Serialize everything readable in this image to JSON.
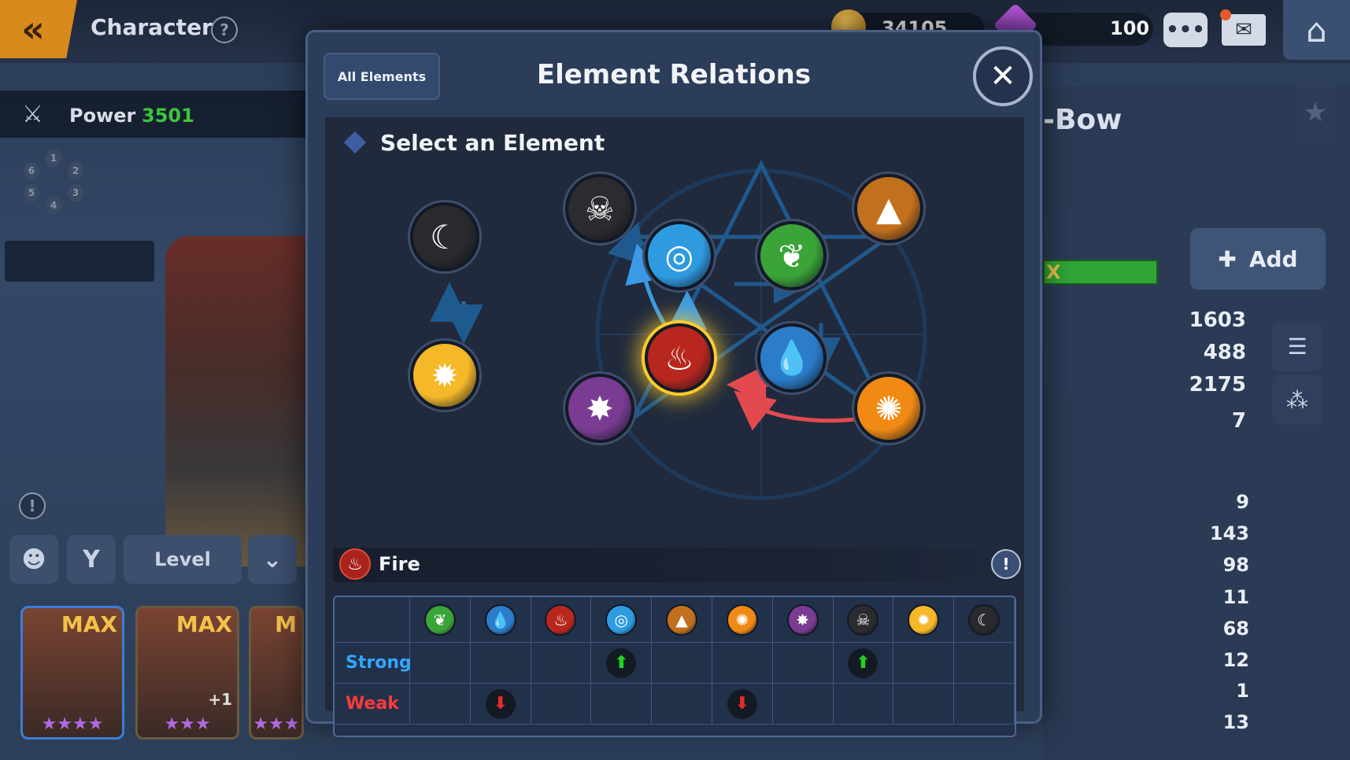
{
  "topbar": {
    "title": "Character",
    "help": "?",
    "coins": "34105",
    "gems": "100"
  },
  "left": {
    "power_label": "Power",
    "power_value": "3501",
    "slots": [
      "1",
      "2",
      "3",
      "4",
      "5",
      "6"
    ],
    "info": "!",
    "level_label": "Level"
  },
  "heroes": [
    {
      "badge": "MAX",
      "stars": "★★★★"
    },
    {
      "badge": "MAX",
      "stars": "★★★",
      "plus": "+1"
    },
    {
      "badge": "M",
      "stars": "★★★"
    }
  ],
  "right": {
    "item_title": "-Bow",
    "add_label": "Add",
    "xp_text": "X",
    "stats_top": [
      "1603",
      "488",
      "2175",
      "7"
    ],
    "stats_bottom": [
      "9",
      "143",
      "98",
      "11",
      "68",
      "12",
      "1",
      "13"
    ]
  },
  "modal": {
    "all_elements_label": "All Elements",
    "title": "Element Relations",
    "close": "✕",
    "select_label": "Select an Element",
    "selected_element": "Fire",
    "info": "!"
  },
  "elements": {
    "moon": {
      "glyph": "☾",
      "color": "#2a2a2e"
    },
    "sun": {
      "glyph": "✹",
      "color": "#f4b829"
    },
    "skull": {
      "glyph": "☠",
      "color": "#2c2c30"
    },
    "wind": {
      "glyph": "◎",
      "color": "#2e9be0"
    },
    "nature": {
      "glyph": "❦",
      "color": "#3aa438"
    },
    "earth": {
      "glyph": "▲",
      "color": "#c2701e"
    },
    "fire": {
      "glyph": "♨",
      "color": "#b8271e"
    },
    "water": {
      "glyph": "💧",
      "color": "#2b7cc9"
    },
    "star": {
      "glyph": "✸",
      "color": "#7a3c92"
    },
    "light": {
      "glyph": "✺",
      "color": "#f08a14"
    }
  },
  "table": {
    "columns": [
      "nature",
      "water",
      "fire",
      "wind",
      "earth",
      "light",
      "star",
      "skull",
      "sun",
      "moon"
    ],
    "rows": [
      {
        "label": "Strong",
        "color": "#33a6ff",
        "marks": [
          "",
          "",
          "",
          "up",
          "",
          "",
          "",
          "up",
          "",
          ""
        ]
      },
      {
        "label": "Weak",
        "color": "#ff3a3a",
        "marks": [
          "",
          "down",
          "",
          "",
          "",
          "down",
          "",
          "",
          "",
          ""
        ]
      }
    ],
    "up_color": "#1ed41e",
    "down_color": "#e52b2b"
  }
}
